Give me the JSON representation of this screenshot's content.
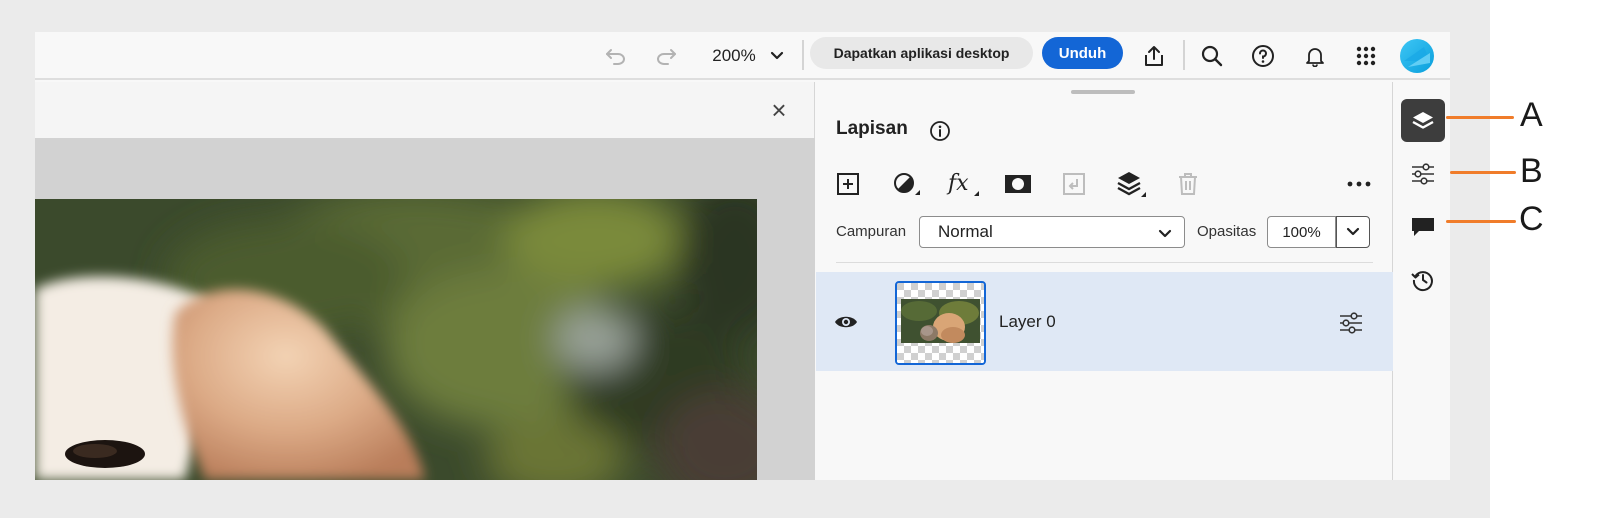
{
  "toolbar": {
    "zoom": "200%",
    "get_desktop_label": "Dapatkan aplikasi desktop",
    "download_label": "Unduh"
  },
  "canvas": {
    "close_symbol": "×"
  },
  "layers_panel": {
    "title": "Lapisan",
    "blend_label": "Campuran",
    "blend_value": "Normal",
    "opacity_label": "Opasitas",
    "opacity_value": "100%",
    "layers": [
      {
        "name": "Layer 0",
        "visible": true,
        "selected": true
      }
    ]
  },
  "callouts": {
    "a": "A",
    "b": "B",
    "c": "C"
  },
  "colors": {
    "accent_blue": "#1366d6",
    "rail_active": "#3d3d3d",
    "callout_orange": "#f07c2a",
    "selected_row": "#dfe8f5"
  }
}
